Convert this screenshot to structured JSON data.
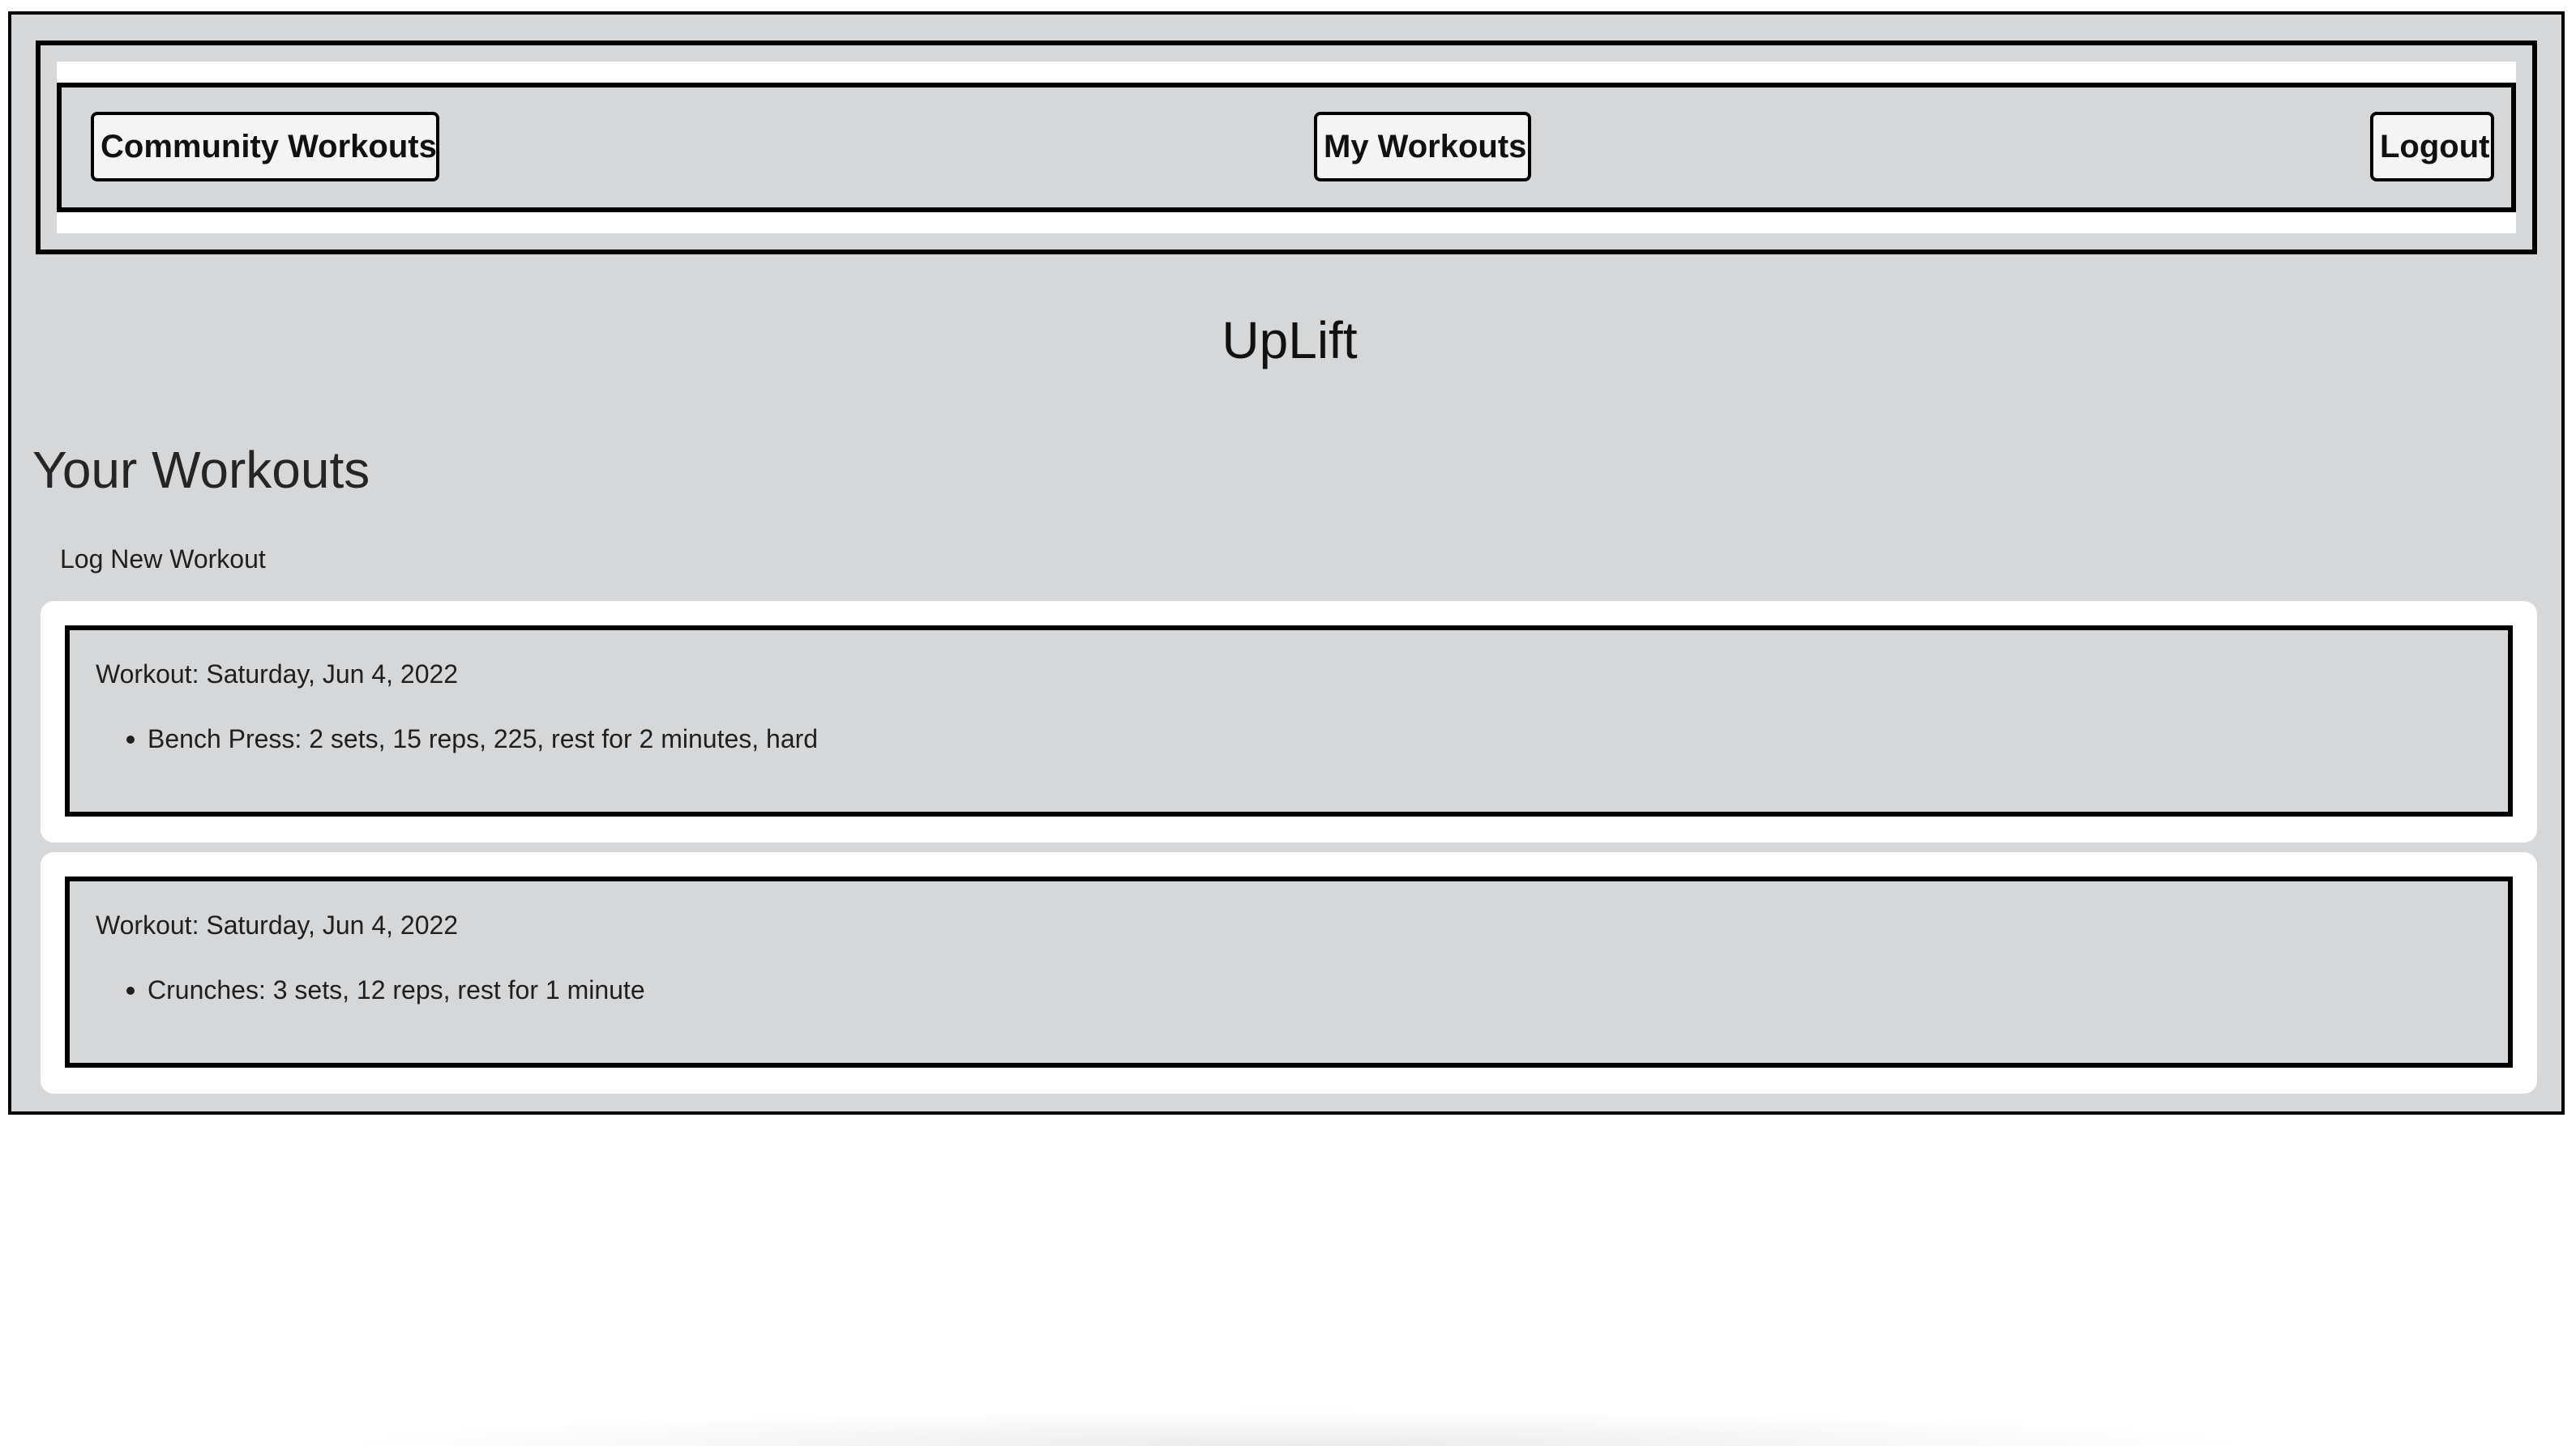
{
  "nav": {
    "community_label": "Community Workouts",
    "my_workouts_label": "My Workouts",
    "logout_label": "Logout"
  },
  "brand": {
    "title": "UpLift"
  },
  "main": {
    "heading": "Your Workouts",
    "log_new_label": "Log New Workout",
    "workouts": [
      {
        "title": "Workout: Saturday, Jun 4, 2022",
        "exercises": [
          "Bench Press: 2 sets, 15 reps, 225, rest for 2 minutes, hard"
        ]
      },
      {
        "title": "Workout: Saturday, Jun 4, 2022",
        "exercises": [
          "Crunches: 3 sets, 12 reps, rest for 1 minute"
        ]
      }
    ]
  },
  "colors": {
    "panel_bg": "#d6d7d9",
    "border": "#000000",
    "card_bg": "#ffffff",
    "button_bg": "#f4f4f5"
  }
}
